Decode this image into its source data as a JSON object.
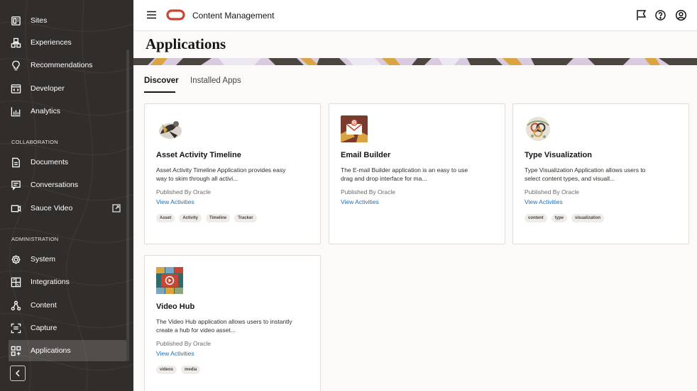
{
  "sidebar": {
    "items_top": [
      {
        "label": "Sites",
        "icon": "sites-icon"
      },
      {
        "label": "Experiences",
        "icon": "experiences-icon"
      },
      {
        "label": "Recommendations",
        "icon": "recommendations-icon"
      },
      {
        "label": "Developer",
        "icon": "developer-icon"
      },
      {
        "label": "Analytics",
        "icon": "analytics-icon"
      }
    ],
    "section_collaboration": "COLLABORATION",
    "items_collab": [
      {
        "label": "Documents",
        "icon": "documents-icon"
      },
      {
        "label": "Conversations",
        "icon": "conversations-icon"
      },
      {
        "label": "Sauce Video",
        "icon": "video-icon"
      }
    ],
    "section_administration": "ADMINISTRATION",
    "items_admin": [
      {
        "label": "System",
        "icon": "gear-icon"
      },
      {
        "label": "Integrations",
        "icon": "integrations-icon"
      },
      {
        "label": "Content",
        "icon": "content-icon"
      },
      {
        "label": "Capture",
        "icon": "capture-icon"
      },
      {
        "label": "Applications",
        "icon": "applications-icon"
      }
    ],
    "active": "Applications"
  },
  "header": {
    "app_title": "Content Management",
    "icons": [
      "flag-icon",
      "help-icon",
      "user-icon"
    ]
  },
  "page": {
    "title": "Applications"
  },
  "tabs": [
    {
      "label": "Discover",
      "active": true
    },
    {
      "label": "Installed Apps",
      "active": false
    }
  ],
  "cards": [
    {
      "title": "Asset Activity Timeline",
      "desc_line1": "Asset Activity Timeline Application provides easy",
      "desc_line2": "way to skim through all activi...",
      "publisher": "Published By Oracle",
      "link": "View Activities",
      "tags": [
        "Asset",
        "Activity",
        "Timeline",
        "Tracker"
      ]
    },
    {
      "title": "Email Builder",
      "desc_line1": "The E-mail Builder application is an easy to use",
      "desc_line2": "drag and drop interface for ma...",
      "publisher": "Published By Oracle",
      "link": "View Activities",
      "tags": []
    },
    {
      "title": "Type Visualization",
      "desc_line1": "Type Visualization Application allows users to",
      "desc_line2": "select content types, and visuall...",
      "publisher": "Published By Oracle",
      "link": "View Activities",
      "tags": [
        "content",
        "type",
        "visualization"
      ]
    },
    {
      "title": "Video Hub",
      "desc_line1": "The Video Hub application allows users to instantly",
      "desc_line2": "create a hub for video asset...",
      "publisher": "Published By Oracle",
      "link": "View Activities",
      "tags": [
        "videos",
        "media"
      ]
    }
  ],
  "colors": {
    "sidebar_bg": "#312d2a",
    "brand_red": "#c74634",
    "link_blue": "#1b6ec2"
  }
}
